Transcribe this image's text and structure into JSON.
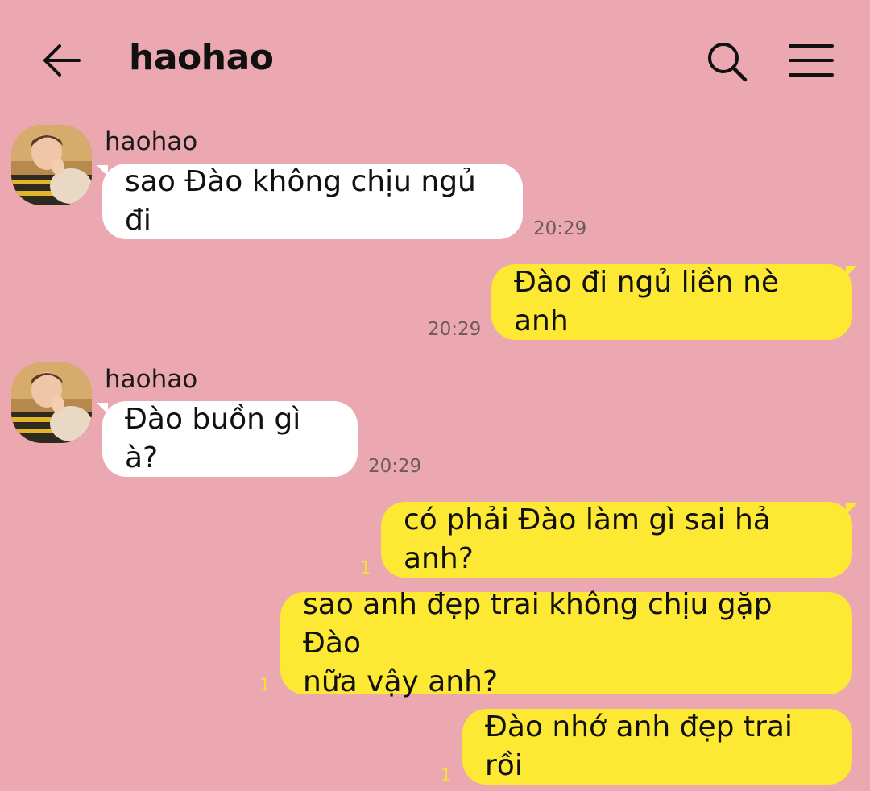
{
  "header": {
    "title": "haohao",
    "back_icon": "arrow-left-icon",
    "search_icon": "search-icon",
    "menu_icon": "hamburger-menu-icon"
  },
  "colors": {
    "background": "#eca8b1",
    "incoming_bubble": "#ffffff",
    "outgoing_bubble": "#fde834",
    "unread_count": "#f3df3a"
  },
  "messages": [
    {
      "direction": "incoming",
      "sender": "haohao",
      "text": "sao Đào không chịu ngủ đi",
      "time": "20:29"
    },
    {
      "direction": "outgoing",
      "text": "Đào đi ngủ liền nè anh",
      "time": "20:29"
    },
    {
      "direction": "incoming",
      "sender": "haohao",
      "text": "Đào buồn gì à?",
      "time": "20:29"
    },
    {
      "direction": "outgoing",
      "text": "có phải Đào làm gì sai hả anh?",
      "unread": "1"
    },
    {
      "direction": "outgoing",
      "text_lines": [
        "sao anh đẹp trai không chịu gặp Đào",
        "nữa vậy anh?"
      ],
      "unread": "1"
    },
    {
      "direction": "outgoing",
      "text": "Đào nhớ anh đẹp trai rồi",
      "unread": "1"
    }
  ]
}
